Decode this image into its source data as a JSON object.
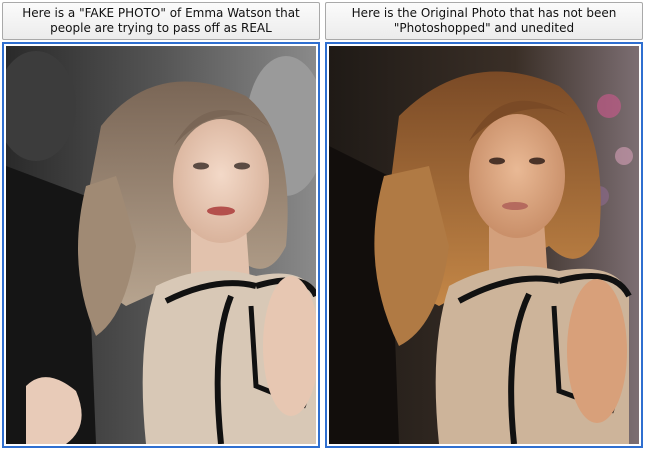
{
  "left_panel": {
    "caption_line1": "Here is a \"FAKE PHOTO\" of Emma Watson that",
    "caption_line2": "people are trying to pass off as REAL",
    "photo_icon": "portrait-photo-muted-tones"
  },
  "right_panel": {
    "caption_line1": "Here is the Original Photo that has not been",
    "caption_line2": "\"Photoshopped\" and unedited",
    "photo_icon": "portrait-photo-warm-tones"
  },
  "colors": {
    "frame_border": "#2f6fd0",
    "caption_border": "#a9a9a9"
  }
}
